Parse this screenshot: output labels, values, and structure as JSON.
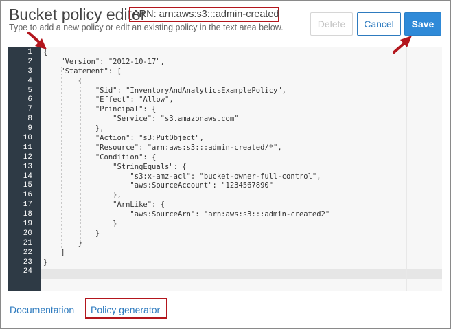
{
  "header": {
    "title": "Bucket policy editor",
    "arn": "ARN: arn:aws:s3:::admin-created",
    "subtitle": "Type to add a new policy or edit an existing policy in the text area below."
  },
  "buttons": {
    "delete": "Delete",
    "cancel": "Cancel",
    "save": "Save"
  },
  "editor": {
    "line_numbers": [
      "1",
      "2",
      "3",
      "4",
      "5",
      "6",
      "7",
      "8",
      "9",
      "10",
      "11",
      "12",
      "13",
      "14",
      "15",
      "16",
      "17",
      "18",
      "19",
      "20",
      "21",
      "22",
      "23",
      "24"
    ],
    "lines": [
      "{",
      "    \"Version\": \"2012-10-17\",",
      "    \"Statement\": [",
      "        {",
      "            \"Sid\": \"InventoryAndAnalyticsExamplePolicy\",",
      "            \"Effect\": \"Allow\",",
      "            \"Principal\": {",
      "                \"Service\": \"s3.amazonaws.com\"",
      "            },",
      "            \"Action\": \"s3:PutObject\",",
      "            \"Resource\": \"arn:aws:s3:::admin-created/*\",",
      "            \"Condition\": {",
      "                \"StringEquals\": {",
      "                    \"s3:x-amz-acl\": \"bucket-owner-full-control\",",
      "                    \"aws:SourceAccount\": \"1234567890\"",
      "                },",
      "                \"ArnLike\": {",
      "                    \"aws:SourceArn\": \"arn:aws:s3:::admin-created2\"",
      "                }",
      "            }",
      "        }",
      "    ]",
      "}",
      ""
    ]
  },
  "footer": {
    "documentation": "Documentation",
    "policy_generator": "Policy generator"
  },
  "colors": {
    "accent": "#2f8ad8",
    "link": "#2e7bbf",
    "highlight": "#b3161d",
    "gutter": "#2e3a45"
  }
}
